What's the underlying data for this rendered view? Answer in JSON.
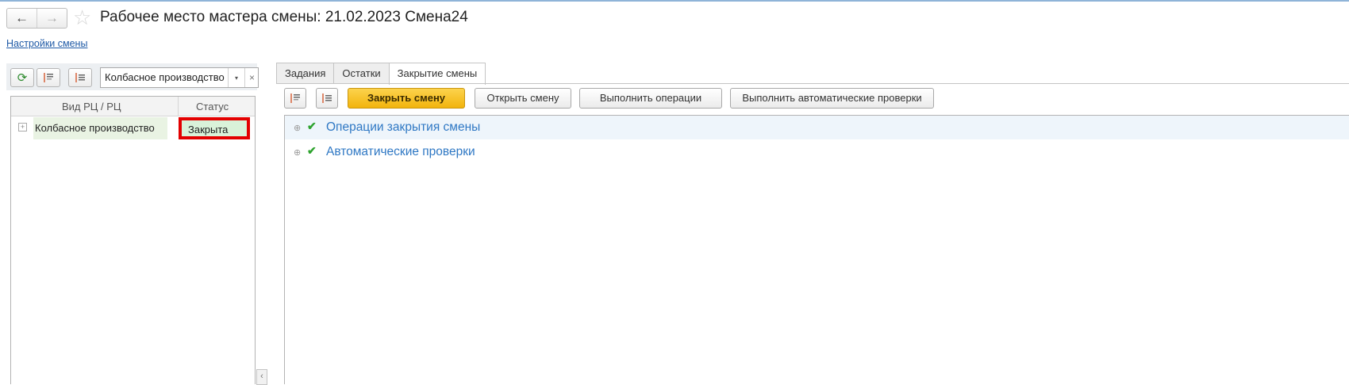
{
  "header": {
    "back_icon": "←",
    "forward_icon": "→",
    "favorite_icon": "☆",
    "title": "Рабочее место мастера смены: 21.02.2023 Смена24",
    "settings_link": "Настройки смены"
  },
  "left_panel": {
    "toolbar": {
      "refresh_icon": "⟳",
      "filter_value": "Колбасное производство",
      "dropdown_icon": "▾",
      "clear_icon": "×"
    },
    "columns": [
      "Вид РЦ / РЦ",
      "Статус"
    ],
    "rows": [
      {
        "expand_icon": "+",
        "name": "Колбасное производство",
        "status": "Закрыта"
      }
    ],
    "collapse_icon": "‹"
  },
  "right_panel": {
    "tabs": [
      {
        "label": "Задания",
        "active": false
      },
      {
        "label": "Остатки",
        "active": false
      },
      {
        "label": "Закрытие смены",
        "active": true
      }
    ],
    "buttons": {
      "close_shift": "Закрыть смену",
      "open_shift": "Открыть смену",
      "run_operations": "Выполнить операции",
      "run_checks": "Выполнить автоматические проверки"
    },
    "tree": [
      {
        "expand_icon": "⊕",
        "check_icon": "✔",
        "label": "Операции закрытия смены"
      },
      {
        "expand_icon": "⊕",
        "check_icon": "✔",
        "label": "Автоматические проверки"
      }
    ]
  },
  "colors": {
    "accent_link": "#2f78c4",
    "primary_button": "#f2b40d",
    "status_highlight_border": "#e30000",
    "status_closed_bg": "#d9f2d9",
    "check_green": "#2ea32e"
  }
}
